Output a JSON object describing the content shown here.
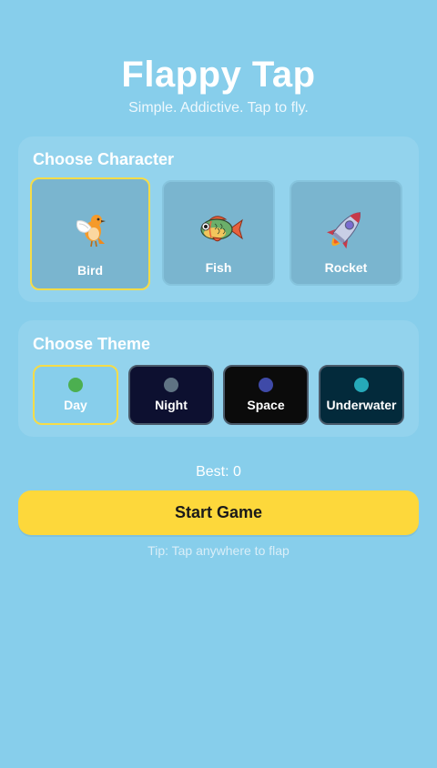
{
  "app": {
    "title": "Flappy Tap",
    "subtitle": "Simple. Addictive. Tap to fly."
  },
  "character_section": {
    "heading": "Choose Character",
    "selected": "Bird",
    "items": [
      {
        "label": "Bird",
        "icon": "bird-icon"
      },
      {
        "label": "Fish",
        "icon": "fish-icon"
      },
      {
        "label": "Rocket",
        "icon": "rocket-icon"
      }
    ]
  },
  "theme_section": {
    "heading": "Choose Theme",
    "selected": "Day",
    "items": [
      {
        "label": "Day",
        "dot_color": "#4CAF50",
        "bg_color": "#87CEEB"
      },
      {
        "label": "Night",
        "dot_color": "#5F7383",
        "bg_color": "#0D1030"
      },
      {
        "label": "Space",
        "dot_color": "#3F4AA8",
        "bg_color": "#0B0B0B"
      },
      {
        "label": "Underwater",
        "dot_color": "#26A9B9",
        "bg_color": "#032A3B"
      }
    ]
  },
  "best": "Best: 0",
  "start_button": "Start Game",
  "tip": "Tip: Tap anywhere to flap",
  "colors": {
    "background": "#87CEEB",
    "accent": "#FDD83B",
    "selected_border": "#F6DC48"
  }
}
